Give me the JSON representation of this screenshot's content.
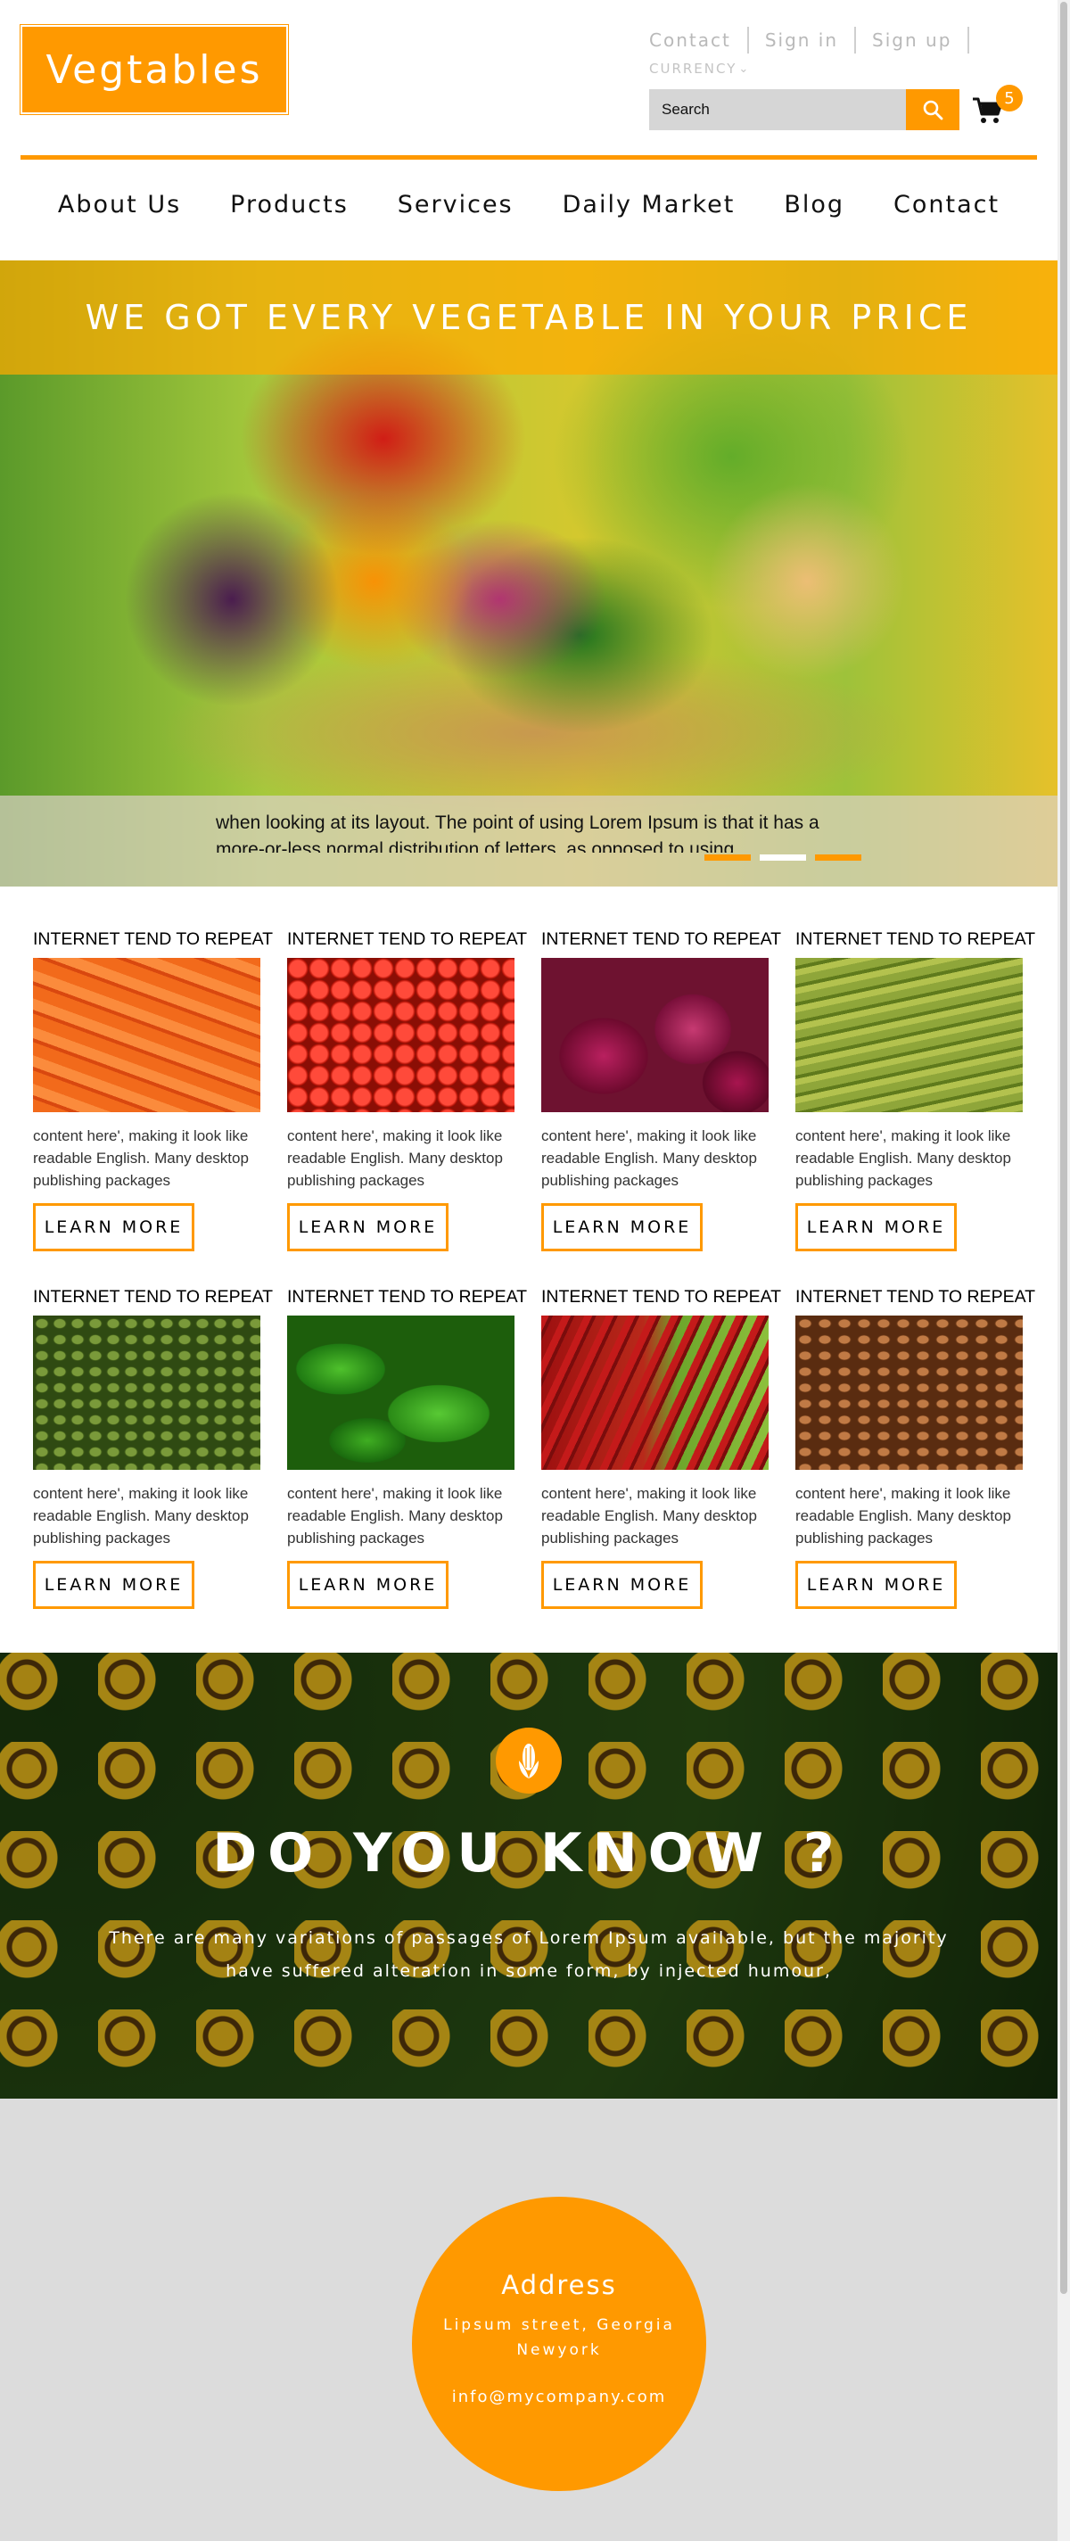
{
  "header": {
    "logo_text": "Vegtables",
    "top_links": [
      "Contact",
      "Sign in",
      "Sign up"
    ],
    "currency_label": "CURRENCY",
    "search_placeholder": "Search",
    "cart_count": "5",
    "accent_color": "#ff9900"
  },
  "nav": {
    "items": [
      "About Us",
      "Products",
      "Services",
      "Daily Market",
      "Blog",
      "Contact"
    ]
  },
  "hero": {
    "title": "WE GOT EVERY VEGETABLE IN YOUR PRICE",
    "caption": "when looking at its layout. The point of using Lorem Ipsum is that it has a more-or-less normal distribution of letters, as opposed to using",
    "slide_count": 3,
    "active_slide": 2
  },
  "products": [
    {
      "title": "INTERNET TEND TO REPEAT",
      "image": "carrots",
      "text": "content here', making it look like readable English. Many desktop publishing packages",
      "button": "LEARN MORE"
    },
    {
      "title": "INTERNET TEND TO REPEAT",
      "image": "tomatoes",
      "text": "content here', making it look like readable English. Many desktop publishing packages",
      "button": "LEARN MORE"
    },
    {
      "title": "INTERNET TEND TO REPEAT",
      "image": "red onions",
      "text": "content here', making it look like readable English. Many desktop publishing packages",
      "button": "LEARN MORE"
    },
    {
      "title": "INTERNET TEND TO REPEAT",
      "image": "green beans",
      "text": "content here', making it look like readable English. Many desktop publishing packages",
      "button": "LEARN MORE"
    },
    {
      "title": "INTERNET TEND TO REPEAT",
      "image": "soybeans",
      "text": "content here', making it look like readable English. Many desktop publishing packages",
      "button": "LEARN MORE"
    },
    {
      "title": "INTERNET TEND TO REPEAT",
      "image": "green peppers",
      "text": "content here', making it look like readable English. Many desktop publishing packages",
      "button": "LEARN MORE"
    },
    {
      "title": "INTERNET TEND TO REPEAT",
      "image": "chili peppers",
      "text": "content here', making it look like readable English. Many desktop publishing packages",
      "button": "LEARN MORE"
    },
    {
      "title": "INTERNET TEND TO REPEAT",
      "image": "coffee beans",
      "text": "content here', making it look like readable English. Many desktop publishing packages",
      "button": "LEARN MORE"
    }
  ],
  "know": {
    "icon": "corn-icon",
    "title": "DO YOU KNOW ?",
    "text": "There are many variations of passages of Lorem Ipsum available, but the majority have suffered alteration in some form, by injected humour,"
  },
  "footer": {
    "title": "Address",
    "line1": "Lipsum street, Georgia",
    "line2": "Newyork",
    "email": "info@mycompany.com"
  }
}
